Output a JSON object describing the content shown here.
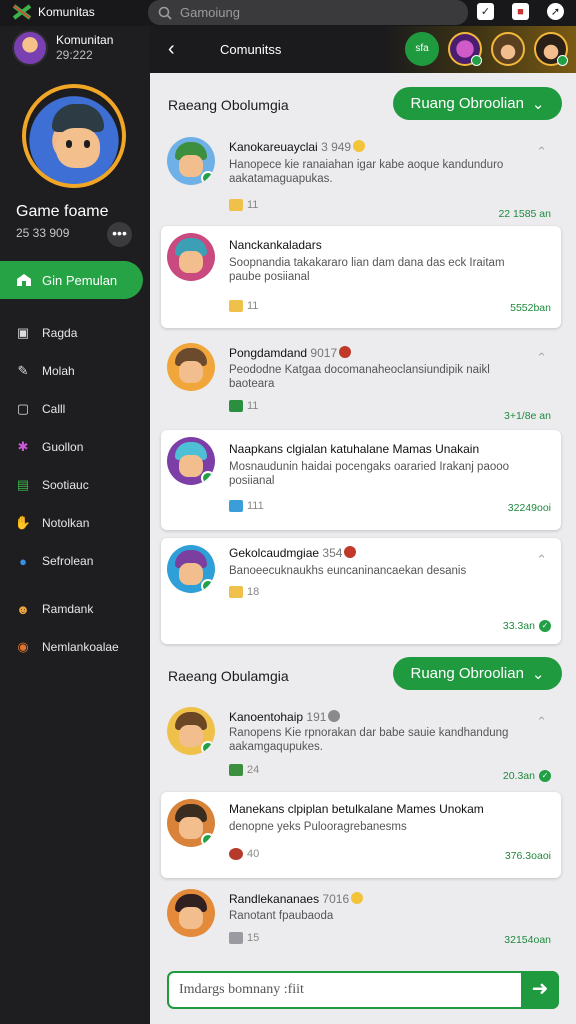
{
  "topbar": {
    "app_title": "Komunitas",
    "search_placeholder": "Gamoiung",
    "icons": [
      "check-badge-icon",
      "gift-icon",
      "compass-icon"
    ]
  },
  "sidebar": {
    "user_name": "Komunitan",
    "user_sub": "29:222",
    "game_name": "Game foame",
    "game_sub": "25 33 909",
    "more_label": "•••",
    "primary_item": "Gin Pemulan",
    "items": [
      {
        "label": "Ragda",
        "icon": "camera-icon"
      },
      {
        "label": "Molah",
        "icon": "pen-icon"
      },
      {
        "label": "Calll",
        "icon": "chat-square-icon"
      },
      {
        "label": "Guollon",
        "icon": "puzzle-icon"
      },
      {
        "label": "Sootiauc",
        "icon": "chart-icon"
      },
      {
        "label": "Notolkan",
        "icon": "hand-icon"
      },
      {
        "label": "Sefrolean",
        "icon": "drop-icon"
      },
      {
        "label": "Ramdank",
        "icon": "user-icon"
      },
      {
        "label": "Nemlankoalae",
        "icon": "bell-icon"
      }
    ]
  },
  "main": {
    "header_title": "Comunitss",
    "header_avatar_badge": "sfa",
    "sections": [
      {
        "title": "Raeang Obolumgia",
        "button": "Ruang Obroolian"
      },
      {
        "title": "Raeang Obulamgia",
        "button": "Ruang Obroolian"
      }
    ],
    "posts": [
      {
        "name": "Kanokareuayclai",
        "meta": "3 949",
        "desc": "Hanopece kie ranaiahan igar kabe aoque kandunduro aakatamaguapukas.",
        "reacts": "11",
        "time": "22 1585 an",
        "colors": {
          "bg": "#6fb0e6",
          "hat": "#3c8f3f"
        }
      },
      {
        "name": "Nanckankaladars",
        "meta": "",
        "desc": "Soopnandia takakararo lian dam dana das eck Iraitam paube posiianal",
        "reacts": "11",
        "time": "5552ban",
        "colors": {
          "bg": "#c94a7f",
          "hat": "#3ba0b5"
        }
      },
      {
        "name": "Pongdamdand",
        "meta": "9017",
        "desc": "Peododne Katgaa docomanaheoclansiundipik naikl baoteara",
        "reacts": "11",
        "time": "3+1/8e an",
        "colors": {
          "bg": "#f0a63a",
          "hat": "#6b4a2e"
        }
      },
      {
        "name": "Naapkans clgialan katuhalane Mamas Unakain",
        "meta": "",
        "desc": "Mosnaudunin haidai pocengaks oararied Irakanj paooo posiianal",
        "reacts": "111",
        "time": "32249ooi",
        "colors": {
          "bg": "#7c3fa8",
          "hat": "#4ec0d6"
        }
      },
      {
        "name": "Gekolcaudmgiae",
        "meta": "354",
        "desc": "Banoeecuknaukhs euncaninancaekan desanis",
        "reacts": "18",
        "time": "33.3an",
        "colors": {
          "bg": "#2f9fd8",
          "hat": "#7a3f9f"
        }
      },
      {
        "name": "Kanoentohaip",
        "meta": "191",
        "desc": "Ranopens Kie rpnorakan dar babe sauie kandhandung aakamgaqupukes.",
        "reacts": "24",
        "time": "20.3an",
        "colors": {
          "bg": "#f0c14a",
          "hat": "#6b4624"
        }
      },
      {
        "name": "Manekans clpiplan betulkalane Mames Unokam",
        "meta": "",
        "desc": "denopne yeks Pulooragrebanesms",
        "reacts": "40",
        "time": "376.3oaoi",
        "colors": {
          "bg": "#d8823a",
          "hat": "#3a2c1e"
        }
      },
      {
        "name": "Randlekananaes",
        "meta": "7016",
        "desc": "Ranotant fpaubaoda",
        "reacts": "15",
        "time": "32154oan",
        "colors": {
          "bg": "#e38b3a",
          "hat": "#302020"
        }
      }
    ],
    "composer_placeholder": "Imdargs bomnany :fiit"
  }
}
